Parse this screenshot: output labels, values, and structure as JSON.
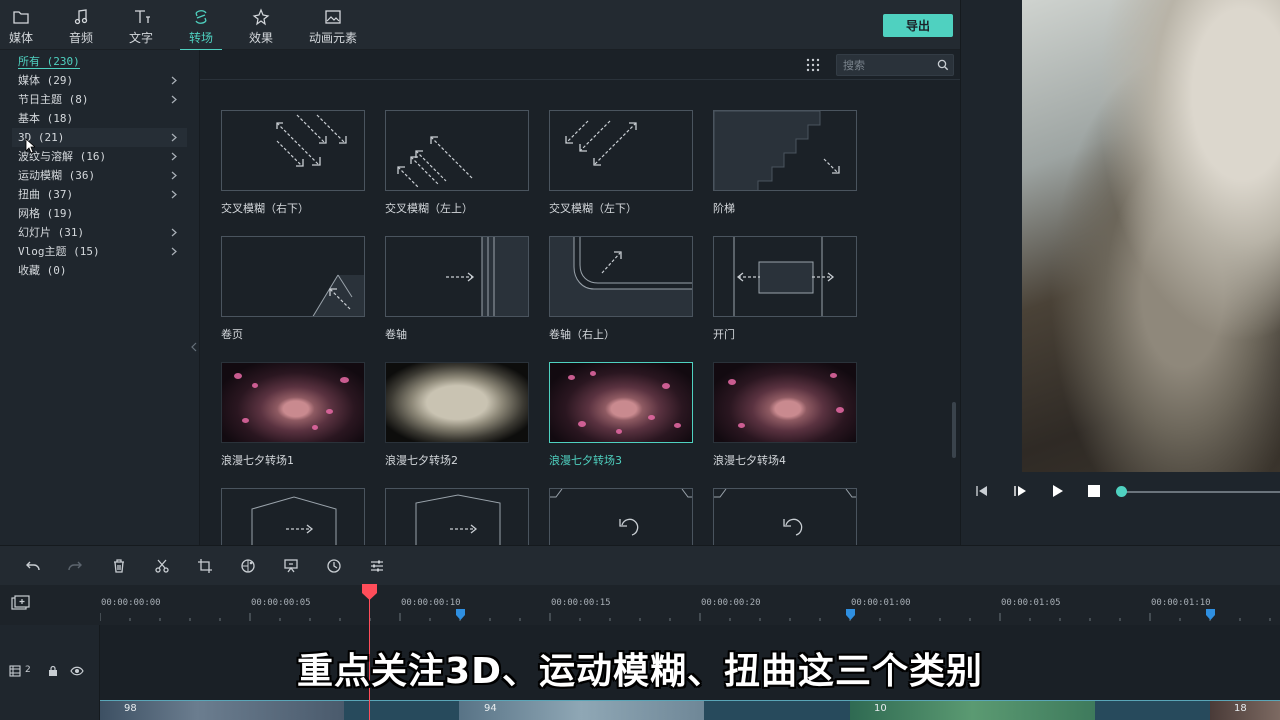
{
  "topbar": {
    "tabs": [
      {
        "label": "媒体",
        "icon": "folder-icon"
      },
      {
        "label": "音频",
        "icon": "music-note-icon"
      },
      {
        "label": "文字",
        "icon": "text-icon"
      },
      {
        "label": "转场",
        "icon": "transition-icon",
        "active": true
      },
      {
        "label": "效果",
        "icon": "effects-icon"
      },
      {
        "label": "动画元素",
        "icon": "image-icon"
      }
    ],
    "export_label": "导出"
  },
  "sidebar": {
    "categories": [
      {
        "label": "所有 (230)",
        "active": true,
        "has_children": false
      },
      {
        "label": "媒体 (29)",
        "has_children": true
      },
      {
        "label": "节日主题 (8)",
        "has_children": true
      },
      {
        "label": "基本 (18)",
        "has_children": false
      },
      {
        "label": "3D (21)",
        "has_children": true,
        "hover": true
      },
      {
        "label": "波纹与溶解 (16)",
        "has_children": true
      },
      {
        "label": "运动模糊 (36)",
        "has_children": true
      },
      {
        "label": "扭曲 (37)",
        "has_children": true
      },
      {
        "label": "网格 (19)",
        "has_children": false
      },
      {
        "label": "幻灯片 (31)",
        "has_children": true
      },
      {
        "label": "Vlog主题 (15)",
        "has_children": true
      },
      {
        "label": "收藏 (0)",
        "has_children": false
      }
    ]
  },
  "browser": {
    "search_placeholder": "搜索",
    "items": [
      {
        "label": "交叉模糊（右下）"
      },
      {
        "label": "交叉模糊（左上）"
      },
      {
        "label": "交叉模糊（左下）"
      },
      {
        "label": "阶梯"
      },
      {
        "label": "卷页"
      },
      {
        "label": "卷轴"
      },
      {
        "label": "卷轴（右上）"
      },
      {
        "label": "开门"
      },
      {
        "label": "浪漫七夕转场1"
      },
      {
        "label": "浪漫七夕转场2"
      },
      {
        "label": "浪漫七夕转场3",
        "selected": true
      },
      {
        "label": "浪漫七夕转场4"
      }
    ]
  },
  "timeline": {
    "timecodes": [
      "00:00:00:00",
      "00:00:00:05",
      "00:00:00:10",
      "00:00:00:15",
      "00:00:00:20",
      "00:00:01:00",
      "00:00:01:05",
      "00:00:01:10"
    ],
    "track_number": "2",
    "clip_numbers": [
      "98",
      "94",
      "10",
      "18"
    ]
  },
  "subtitle": "重点关注3D、运动模糊、扭曲这三个类别",
  "colors": {
    "accent": "#4fd1c0",
    "playhead": "#ff4d5a",
    "marker": "#2f8fe0"
  }
}
